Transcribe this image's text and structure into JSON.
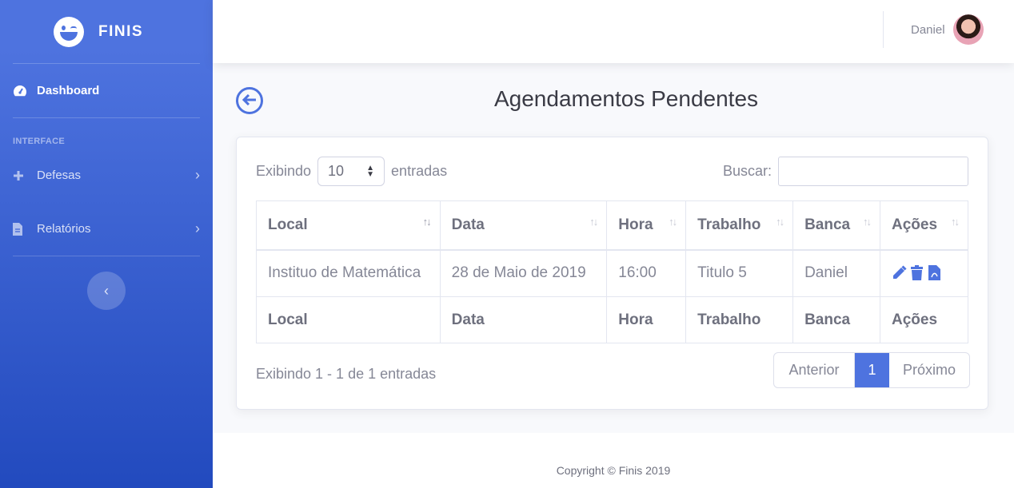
{
  "brand": {
    "name": "FINIS"
  },
  "sidebar": {
    "dashboard_label": "Dashboard",
    "heading": "INTERFACE",
    "items": [
      {
        "label": "Defesas",
        "icon": "plus-icon"
      },
      {
        "label": "Relatórios",
        "icon": "file-icon"
      }
    ],
    "toggle_icon": "chevron-left-icon"
  },
  "topbar": {
    "username": "Daniel"
  },
  "page": {
    "title": "Agendamentos Pendentes"
  },
  "table_controls": {
    "show_prefix": "Exibindo",
    "show_value": "10",
    "show_suffix": "entradas",
    "search_label": "Buscar:",
    "search_value": ""
  },
  "table": {
    "headers": [
      "Local",
      "Data",
      "Hora",
      "Trabalho",
      "Banca",
      "Ações"
    ],
    "rows": [
      {
        "local": "Instituo de Matemática",
        "data": "28 de Maio de 2019",
        "hora": "16:00",
        "trabalho": "Titulo 5",
        "banca": "Daniel"
      }
    ],
    "footers": [
      "Local",
      "Data",
      "Hora",
      "Trabalho",
      "Banca",
      "Ações"
    ]
  },
  "info_text": "Exibindo 1 - 1 de 1 entradas",
  "pagination": {
    "prev": "Anterior",
    "current": "1",
    "next": "Próximo"
  },
  "footer": {
    "copyright": "Copyright © Finis 2019"
  },
  "colors": {
    "primary": "#4e73df",
    "sidebar_end": "#224abe"
  }
}
